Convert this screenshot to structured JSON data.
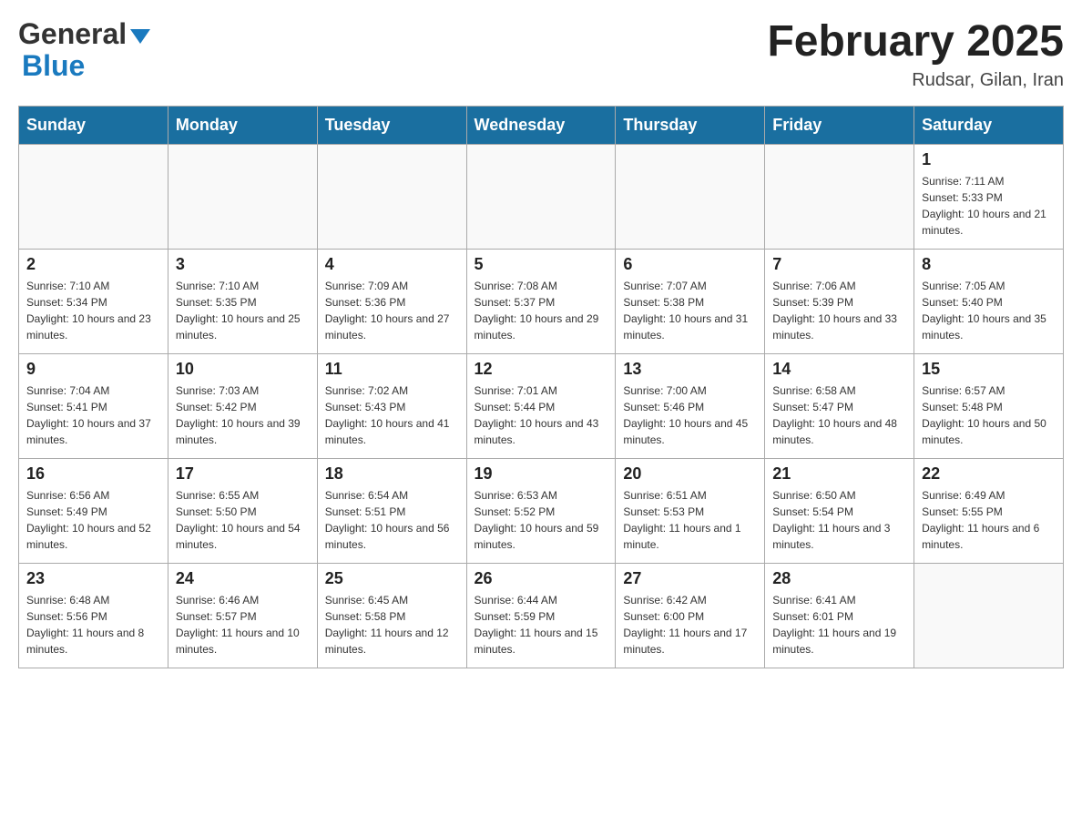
{
  "logo": {
    "general": "General",
    "blue": "Blue"
  },
  "title": "February 2025",
  "location": "Rudsar, Gilan, Iran",
  "columns": [
    "Sunday",
    "Monday",
    "Tuesday",
    "Wednesday",
    "Thursday",
    "Friday",
    "Saturday"
  ],
  "weeks": [
    [
      {
        "day": "",
        "sunrise": "",
        "sunset": "",
        "daylight": ""
      },
      {
        "day": "",
        "sunrise": "",
        "sunset": "",
        "daylight": ""
      },
      {
        "day": "",
        "sunrise": "",
        "sunset": "",
        "daylight": ""
      },
      {
        "day": "",
        "sunrise": "",
        "sunset": "",
        "daylight": ""
      },
      {
        "day": "",
        "sunrise": "",
        "sunset": "",
        "daylight": ""
      },
      {
        "day": "",
        "sunrise": "",
        "sunset": "",
        "daylight": ""
      },
      {
        "day": "1",
        "sunrise": "Sunrise: 7:11 AM",
        "sunset": "Sunset: 5:33 PM",
        "daylight": "Daylight: 10 hours and 21 minutes."
      }
    ],
    [
      {
        "day": "2",
        "sunrise": "Sunrise: 7:10 AM",
        "sunset": "Sunset: 5:34 PM",
        "daylight": "Daylight: 10 hours and 23 minutes."
      },
      {
        "day": "3",
        "sunrise": "Sunrise: 7:10 AM",
        "sunset": "Sunset: 5:35 PM",
        "daylight": "Daylight: 10 hours and 25 minutes."
      },
      {
        "day": "4",
        "sunrise": "Sunrise: 7:09 AM",
        "sunset": "Sunset: 5:36 PM",
        "daylight": "Daylight: 10 hours and 27 minutes."
      },
      {
        "day": "5",
        "sunrise": "Sunrise: 7:08 AM",
        "sunset": "Sunset: 5:37 PM",
        "daylight": "Daylight: 10 hours and 29 minutes."
      },
      {
        "day": "6",
        "sunrise": "Sunrise: 7:07 AM",
        "sunset": "Sunset: 5:38 PM",
        "daylight": "Daylight: 10 hours and 31 minutes."
      },
      {
        "day": "7",
        "sunrise": "Sunrise: 7:06 AM",
        "sunset": "Sunset: 5:39 PM",
        "daylight": "Daylight: 10 hours and 33 minutes."
      },
      {
        "day": "8",
        "sunrise": "Sunrise: 7:05 AM",
        "sunset": "Sunset: 5:40 PM",
        "daylight": "Daylight: 10 hours and 35 minutes."
      }
    ],
    [
      {
        "day": "9",
        "sunrise": "Sunrise: 7:04 AM",
        "sunset": "Sunset: 5:41 PM",
        "daylight": "Daylight: 10 hours and 37 minutes."
      },
      {
        "day": "10",
        "sunrise": "Sunrise: 7:03 AM",
        "sunset": "Sunset: 5:42 PM",
        "daylight": "Daylight: 10 hours and 39 minutes."
      },
      {
        "day": "11",
        "sunrise": "Sunrise: 7:02 AM",
        "sunset": "Sunset: 5:43 PM",
        "daylight": "Daylight: 10 hours and 41 minutes."
      },
      {
        "day": "12",
        "sunrise": "Sunrise: 7:01 AM",
        "sunset": "Sunset: 5:44 PM",
        "daylight": "Daylight: 10 hours and 43 minutes."
      },
      {
        "day": "13",
        "sunrise": "Sunrise: 7:00 AM",
        "sunset": "Sunset: 5:46 PM",
        "daylight": "Daylight: 10 hours and 45 minutes."
      },
      {
        "day": "14",
        "sunrise": "Sunrise: 6:58 AM",
        "sunset": "Sunset: 5:47 PM",
        "daylight": "Daylight: 10 hours and 48 minutes."
      },
      {
        "day": "15",
        "sunrise": "Sunrise: 6:57 AM",
        "sunset": "Sunset: 5:48 PM",
        "daylight": "Daylight: 10 hours and 50 minutes."
      }
    ],
    [
      {
        "day": "16",
        "sunrise": "Sunrise: 6:56 AM",
        "sunset": "Sunset: 5:49 PM",
        "daylight": "Daylight: 10 hours and 52 minutes."
      },
      {
        "day": "17",
        "sunrise": "Sunrise: 6:55 AM",
        "sunset": "Sunset: 5:50 PM",
        "daylight": "Daylight: 10 hours and 54 minutes."
      },
      {
        "day": "18",
        "sunrise": "Sunrise: 6:54 AM",
        "sunset": "Sunset: 5:51 PM",
        "daylight": "Daylight: 10 hours and 56 minutes."
      },
      {
        "day": "19",
        "sunrise": "Sunrise: 6:53 AM",
        "sunset": "Sunset: 5:52 PM",
        "daylight": "Daylight: 10 hours and 59 minutes."
      },
      {
        "day": "20",
        "sunrise": "Sunrise: 6:51 AM",
        "sunset": "Sunset: 5:53 PM",
        "daylight": "Daylight: 11 hours and 1 minute."
      },
      {
        "day": "21",
        "sunrise": "Sunrise: 6:50 AM",
        "sunset": "Sunset: 5:54 PM",
        "daylight": "Daylight: 11 hours and 3 minutes."
      },
      {
        "day": "22",
        "sunrise": "Sunrise: 6:49 AM",
        "sunset": "Sunset: 5:55 PM",
        "daylight": "Daylight: 11 hours and 6 minutes."
      }
    ],
    [
      {
        "day": "23",
        "sunrise": "Sunrise: 6:48 AM",
        "sunset": "Sunset: 5:56 PM",
        "daylight": "Daylight: 11 hours and 8 minutes."
      },
      {
        "day": "24",
        "sunrise": "Sunrise: 6:46 AM",
        "sunset": "Sunset: 5:57 PM",
        "daylight": "Daylight: 11 hours and 10 minutes."
      },
      {
        "day": "25",
        "sunrise": "Sunrise: 6:45 AM",
        "sunset": "Sunset: 5:58 PM",
        "daylight": "Daylight: 11 hours and 12 minutes."
      },
      {
        "day": "26",
        "sunrise": "Sunrise: 6:44 AM",
        "sunset": "Sunset: 5:59 PM",
        "daylight": "Daylight: 11 hours and 15 minutes."
      },
      {
        "day": "27",
        "sunrise": "Sunrise: 6:42 AM",
        "sunset": "Sunset: 6:00 PM",
        "daylight": "Daylight: 11 hours and 17 minutes."
      },
      {
        "day": "28",
        "sunrise": "Sunrise: 6:41 AM",
        "sunset": "Sunset: 6:01 PM",
        "daylight": "Daylight: 11 hours and 19 minutes."
      },
      {
        "day": "",
        "sunrise": "",
        "sunset": "",
        "daylight": ""
      }
    ]
  ]
}
